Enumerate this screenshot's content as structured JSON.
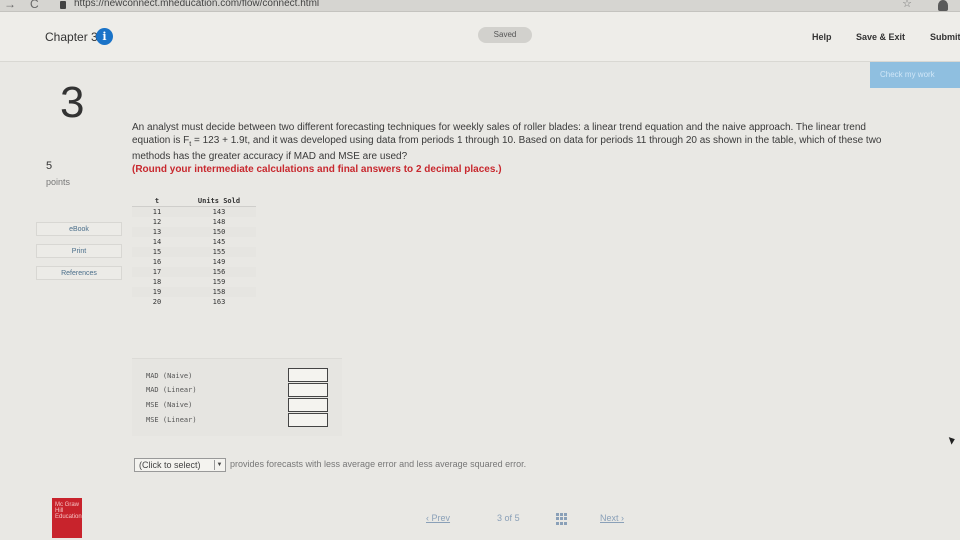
{
  "browser": {
    "url": "https://newconnect.mheducation.com/flow/connect.html",
    "back_glyph": "→",
    "reload_glyph": "C",
    "star_glyph": "☆"
  },
  "header": {
    "chapter": "Chapter 3",
    "info_glyph": "i",
    "saved": "Saved",
    "help": "Help",
    "save_exit": "Save & Exit",
    "submit": "Submit",
    "check_work": "Check my work"
  },
  "question": {
    "number": "3",
    "points_value": "5",
    "points_label": "points",
    "text_1": "An analyst must decide between two different forecasting techniques for weekly sales of roller blades: a linear trend equation and the naive approach. The linear trend equation is ",
    "formula": "F",
    "formula_sub": "t",
    "text_2": " = 123 + 1.9t, and it was developed using data from periods 1 through 10. Based on data for periods 11 through 20 as shown in the table, which of these two methods has the greater accuracy if MAD and MSE are used?",
    "round_note": "(Round your intermediate calculations and final answers to 2 decimal places.)"
  },
  "rail": {
    "ebook": "eBook",
    "print": "Print",
    "references": "References"
  },
  "table": {
    "col_t": "t",
    "col_units": "Units Sold",
    "rows": [
      [
        "11",
        "143"
      ],
      [
        "12",
        "148"
      ],
      [
        "13",
        "150"
      ],
      [
        "14",
        "145"
      ],
      [
        "15",
        "155"
      ],
      [
        "16",
        "149"
      ],
      [
        "17",
        "156"
      ],
      [
        "18",
        "159"
      ],
      [
        "19",
        "158"
      ],
      [
        "20",
        "163"
      ]
    ]
  },
  "answers": {
    "mad_naive": "MAD (Naive)",
    "mad_linear": "MAD (Linear)",
    "mse_naive": "MSE (Naive)",
    "mse_linear": "MSE (Linear)",
    "mad_naive_value": "",
    "mad_linear_value": "",
    "mse_naive_value": "",
    "mse_linear_value": ""
  },
  "select": {
    "value": "(Click to select)",
    "arrow": "▼"
  },
  "provides_text": "provides forecasts with less average error and less average squared error.",
  "footer": {
    "logo_text": "Mc Graw Hill Education",
    "prev": "Prev",
    "prev_glyph": "‹",
    "current": "3",
    "of": "of",
    "total": "5",
    "next": "Next",
    "next_glyph": "›"
  }
}
